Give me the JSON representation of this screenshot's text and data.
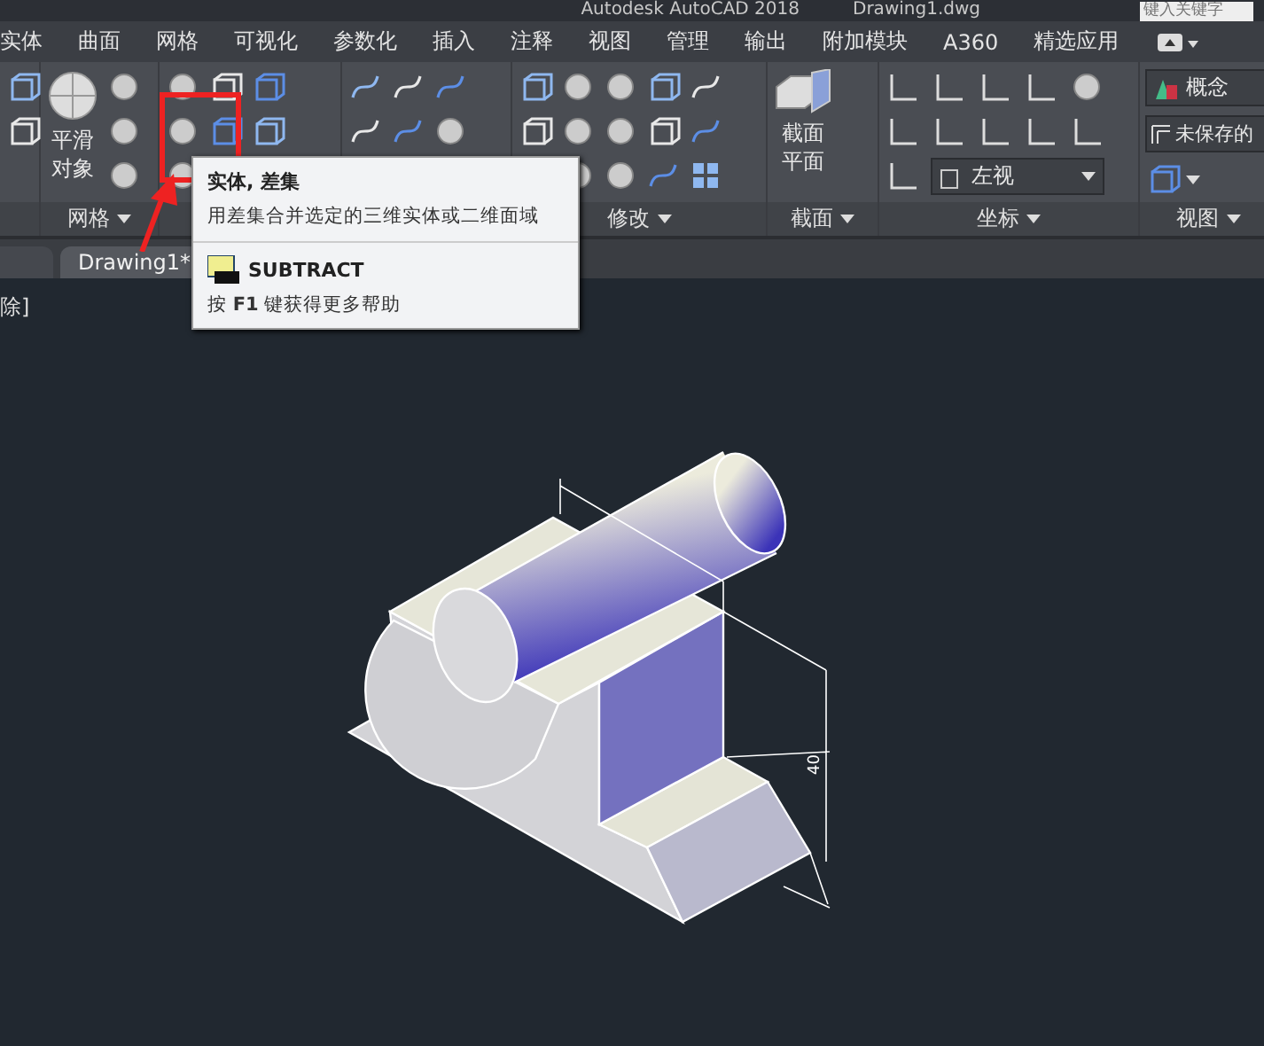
{
  "window": {
    "title": "Autodesk AutoCAD 2018",
    "file": "Drawing1.dwg",
    "search_placeholder": "键入关键字"
  },
  "ribbon_tabs": [
    "实体",
    "曲面",
    "网格",
    "可视化",
    "参数化",
    "插入",
    "注释",
    "视图",
    "管理",
    "输出",
    "附加模块",
    "A360",
    "精选应用"
  ],
  "panels": [
    {
      "kind": "small"
    },
    {
      "kind": "mesh",
      "label": "网格",
      "big_button": "平滑对象"
    },
    {
      "kind": "solidedit"
    },
    {
      "kind": "draw"
    },
    {
      "kind": "modify",
      "label": "修改"
    },
    {
      "kind": "section",
      "label": "截面",
      "big_button": "截面平面"
    },
    {
      "kind": "ucs",
      "label": "坐标",
      "dropdown": "左视"
    },
    {
      "kind": "view",
      "label": "视图",
      "style": "概念",
      "saved_view": "未保存的"
    }
  ],
  "doc_tabs": [
    {
      "label": "Drawing1*",
      "selected": true
    }
  ],
  "command_text": "除]",
  "tooltip": {
    "title": "实体, 差集",
    "description": "用差集合并选定的三维实体或二维面域",
    "command": "SUBTRACT",
    "help": "按 **F1** 键获得更多帮助"
  },
  "model": {
    "dimension": "40"
  }
}
